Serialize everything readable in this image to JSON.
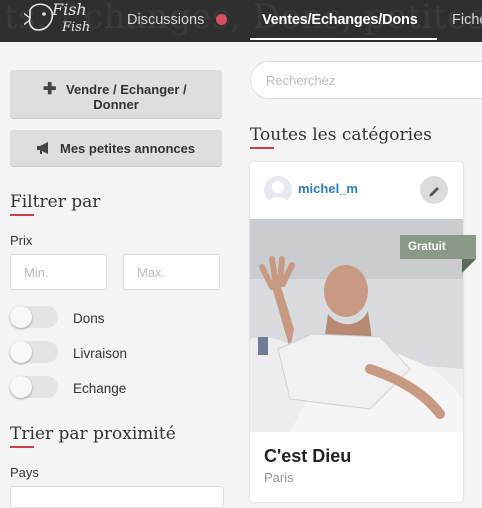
{
  "header": {
    "bg_title": "ts, Echanges, Dons, petites annonc",
    "logo_line1": "Fish",
    "logo_line2": "Fish",
    "nav": [
      {
        "label": "Discussions"
      },
      {
        "label": "Ventes/Echanges/Dons"
      },
      {
        "label": "Fiche"
      }
    ],
    "notification_color": "#d64f5e"
  },
  "sidebar": {
    "sell_button": {
      "line1": "Vendre / Echanger /",
      "line2": "Donner",
      "icon": "plus-icon"
    },
    "my_ads_button": {
      "label": "Mes petites annonces",
      "icon": "megaphone-icon"
    },
    "filter_title": "Filtrer par",
    "price_label": "Prix",
    "min_placeholder": "Min.",
    "max_placeholder": "Max.",
    "toggles": [
      {
        "label": "Dons",
        "on": false
      },
      {
        "label": "Livraison",
        "on": false
      },
      {
        "label": "Echange",
        "on": false
      }
    ],
    "sort_title": "Trier par proximité",
    "country_label": "Pays"
  },
  "main": {
    "search_placeholder": "Recherchez",
    "category_title": "Toutes les catégories",
    "accent_color": "#c8434f",
    "card": {
      "username": "michel_m",
      "badge": "Gratuit",
      "title": "C'est Dieu",
      "city": "Paris"
    }
  }
}
